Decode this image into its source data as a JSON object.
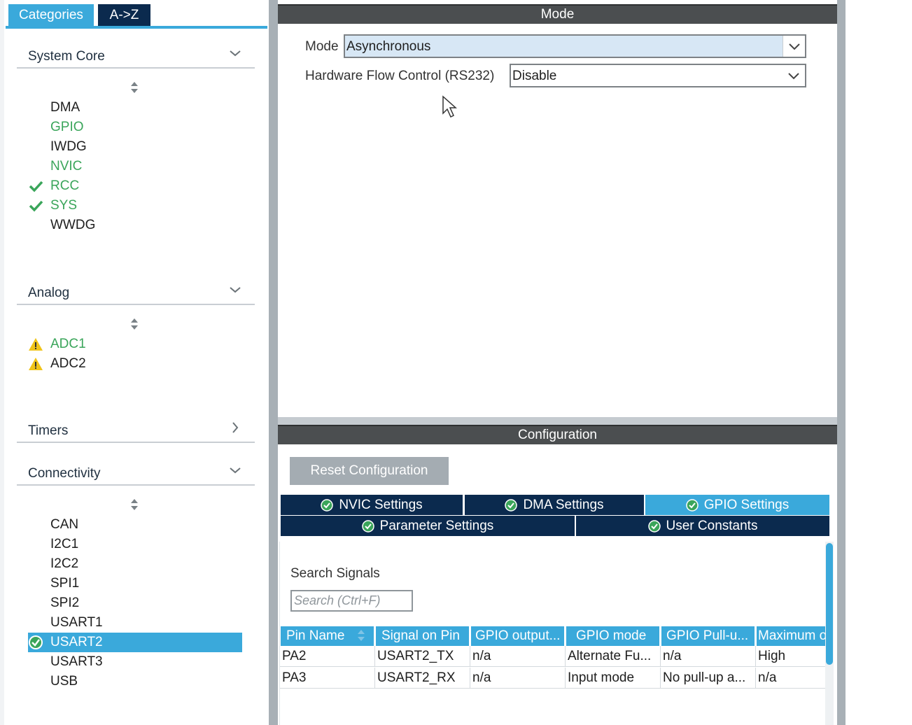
{
  "sidebar": {
    "tabs": [
      "Categories",
      "A->Z"
    ],
    "sections": [
      {
        "title": "System Core",
        "expanded": true,
        "items": [
          {
            "label": "DMA",
            "color": "default",
            "icon": ""
          },
          {
            "label": "GPIO",
            "color": "green",
            "icon": ""
          },
          {
            "label": "IWDG",
            "color": "default",
            "icon": ""
          },
          {
            "label": "NVIC",
            "color": "green",
            "icon": ""
          },
          {
            "label": "RCC",
            "color": "green",
            "icon": "green-check-icon"
          },
          {
            "label": "SYS",
            "color": "green",
            "icon": "green-check-icon"
          },
          {
            "label": "WWDG",
            "color": "default",
            "icon": ""
          }
        ]
      },
      {
        "title": "Analog",
        "expanded": true,
        "items": [
          {
            "label": "ADC1",
            "color": "green",
            "icon": "warning-icon"
          },
          {
            "label": "ADC2",
            "color": "default",
            "icon": "warning-icon"
          }
        ]
      },
      {
        "title": "Timers",
        "expanded": false,
        "items": []
      },
      {
        "title": "Connectivity",
        "expanded": true,
        "items": [
          {
            "label": "CAN",
            "color": "default",
            "icon": ""
          },
          {
            "label": "I2C1",
            "color": "default",
            "icon": ""
          },
          {
            "label": "I2C2",
            "color": "default",
            "icon": ""
          },
          {
            "label": "SPI1",
            "color": "default",
            "icon": ""
          },
          {
            "label": "SPI2",
            "color": "default",
            "icon": ""
          },
          {
            "label": "USART1",
            "color": "default",
            "icon": ""
          },
          {
            "label": "USART2",
            "color": "selected",
            "icon": "circle-check-icon"
          },
          {
            "label": "USART3",
            "color": "default",
            "icon": ""
          },
          {
            "label": "USB",
            "color": "default",
            "icon": ""
          }
        ]
      }
    ]
  },
  "mode_panel": {
    "title": "Mode",
    "mode_label": "Mode",
    "mode_value": "Asynchronous",
    "flow_label": "Hardware Flow Control (RS232)",
    "flow_value": "Disable"
  },
  "config_panel": {
    "title": "Configuration",
    "reset_label": "Reset Configuration",
    "tabs": [
      "NVIC Settings",
      "DMA Settings",
      "GPIO Settings",
      "Parameter Settings",
      "User Constants"
    ],
    "active_tab": "GPIO Settings",
    "search_label": "Search Signals",
    "search_placeholder": "Search (Ctrl+F)",
    "table": {
      "headers": [
        "Pin Name",
        "Signal on Pin",
        "GPIO output...",
        "GPIO mode",
        "GPIO Pull-u...",
        "Maximum o"
      ],
      "rows": [
        [
          "PA2",
          "USART2_TX",
          "n/a",
          "Alternate Fu...",
          "n/a",
          "High"
        ],
        [
          "PA3",
          "USART2_RX",
          "n/a",
          "Input mode",
          "No pull-up a...",
          "n/a"
        ]
      ]
    }
  },
  "colors": {
    "accent": "#3aa9db",
    "navy": "#0b2a4e",
    "title_bar": "#4b4e50",
    "green": "#3aa55a",
    "warning": "#f0c419"
  }
}
